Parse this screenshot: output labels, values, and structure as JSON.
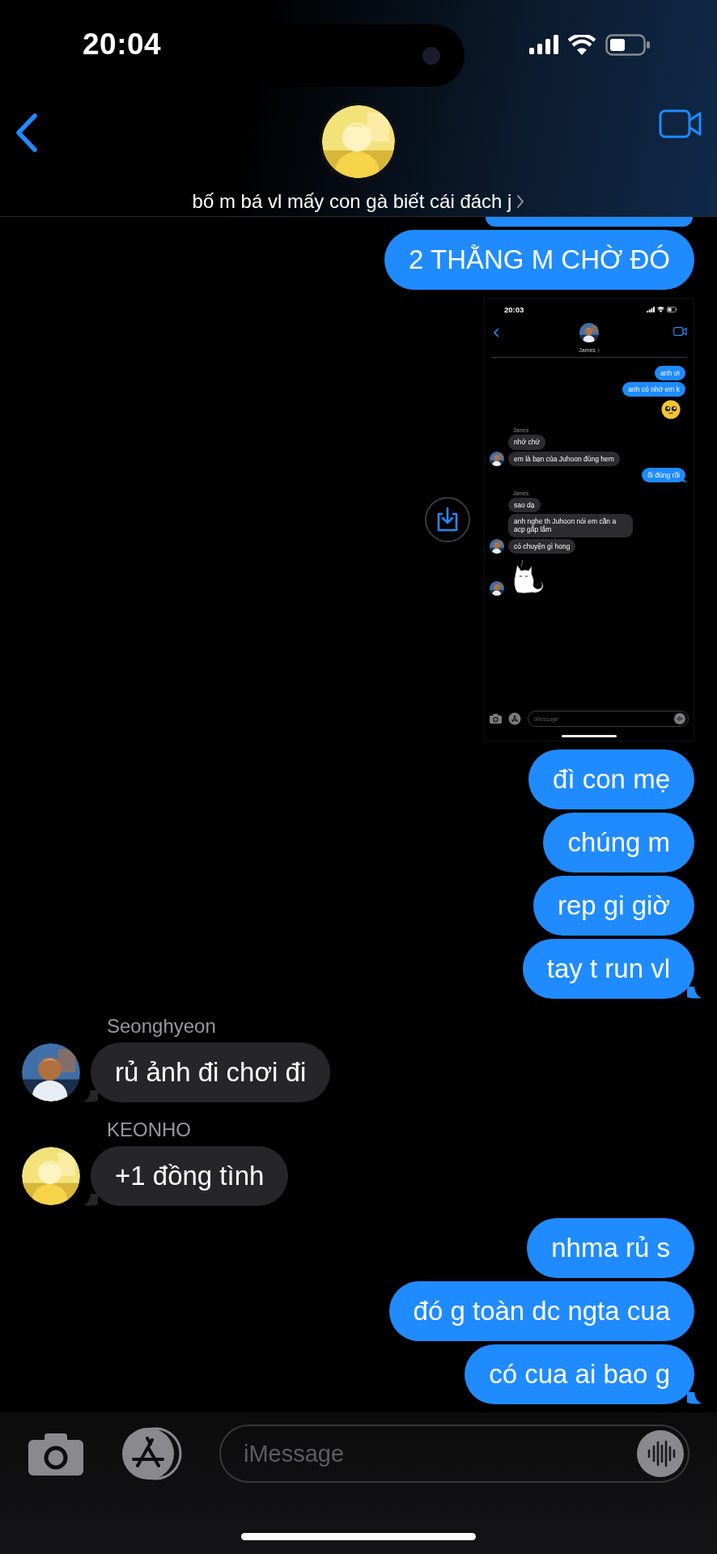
{
  "status_bar": {
    "time": "20:04"
  },
  "header": {
    "contact_name": "bố m bá vl mấy con gà biết cái đách j"
  },
  "messages": [
    {
      "kind": "sent_cut"
    },
    {
      "kind": "sent",
      "text": "2 THẰNG M CHỜ ĐÓ",
      "tail": false
    },
    {
      "kind": "screenshot",
      "status_time": "20:03",
      "contact_name": "James",
      "composer_placeholder": "iMessage",
      "messages": [
        {
          "kind": "sent",
          "text": "anh ơi",
          "tail": false
        },
        {
          "kind": "sent",
          "text": "anh có nhớ em k",
          "tail": false
        },
        {
          "kind": "emoji"
        },
        {
          "kind": "received",
          "sender": "James",
          "text": "nhớ chứ",
          "avatar": false
        },
        {
          "kind": "received",
          "text": "em là bạn của Juhoon đúng hem",
          "avatar": true
        },
        {
          "kind": "sent",
          "text": "ối đúng rồi",
          "tail": true
        },
        {
          "kind": "received",
          "sender": "James",
          "text": "sao dạ",
          "avatar": false
        },
        {
          "kind": "received",
          "text": "anh nghe th Juhoon nói em cần a acp gấp lắm",
          "avatar": false
        },
        {
          "kind": "received",
          "text": "có chuyện gì hong",
          "avatar": true
        },
        {
          "kind": "sticker",
          "avatar": true
        }
      ]
    },
    {
      "kind": "sent",
      "text": "đì con mẹ",
      "tail": false
    },
    {
      "kind": "sent",
      "text": "chúng m",
      "tail": false
    },
    {
      "kind": "sent",
      "text": "rep gi giờ",
      "tail": false
    },
    {
      "kind": "sent",
      "text": "tay t run vl",
      "tail": true
    },
    {
      "kind": "received",
      "sender": "Seonghyeon",
      "text": "rủ ảnh đi chơi đi",
      "avatar": true
    },
    {
      "kind": "received",
      "sender": "KEONHO",
      "text": "+1 đồng tình",
      "avatar": true
    },
    {
      "kind": "sent",
      "text": "nhma rủ s",
      "tail": false
    },
    {
      "kind": "sent",
      "text": "đó g toàn dc ngta cua",
      "tail": false
    },
    {
      "kind": "sent",
      "text": "có cua ai bao g",
      "tail": true
    }
  ],
  "composer": {
    "placeholder": "iMessage"
  }
}
